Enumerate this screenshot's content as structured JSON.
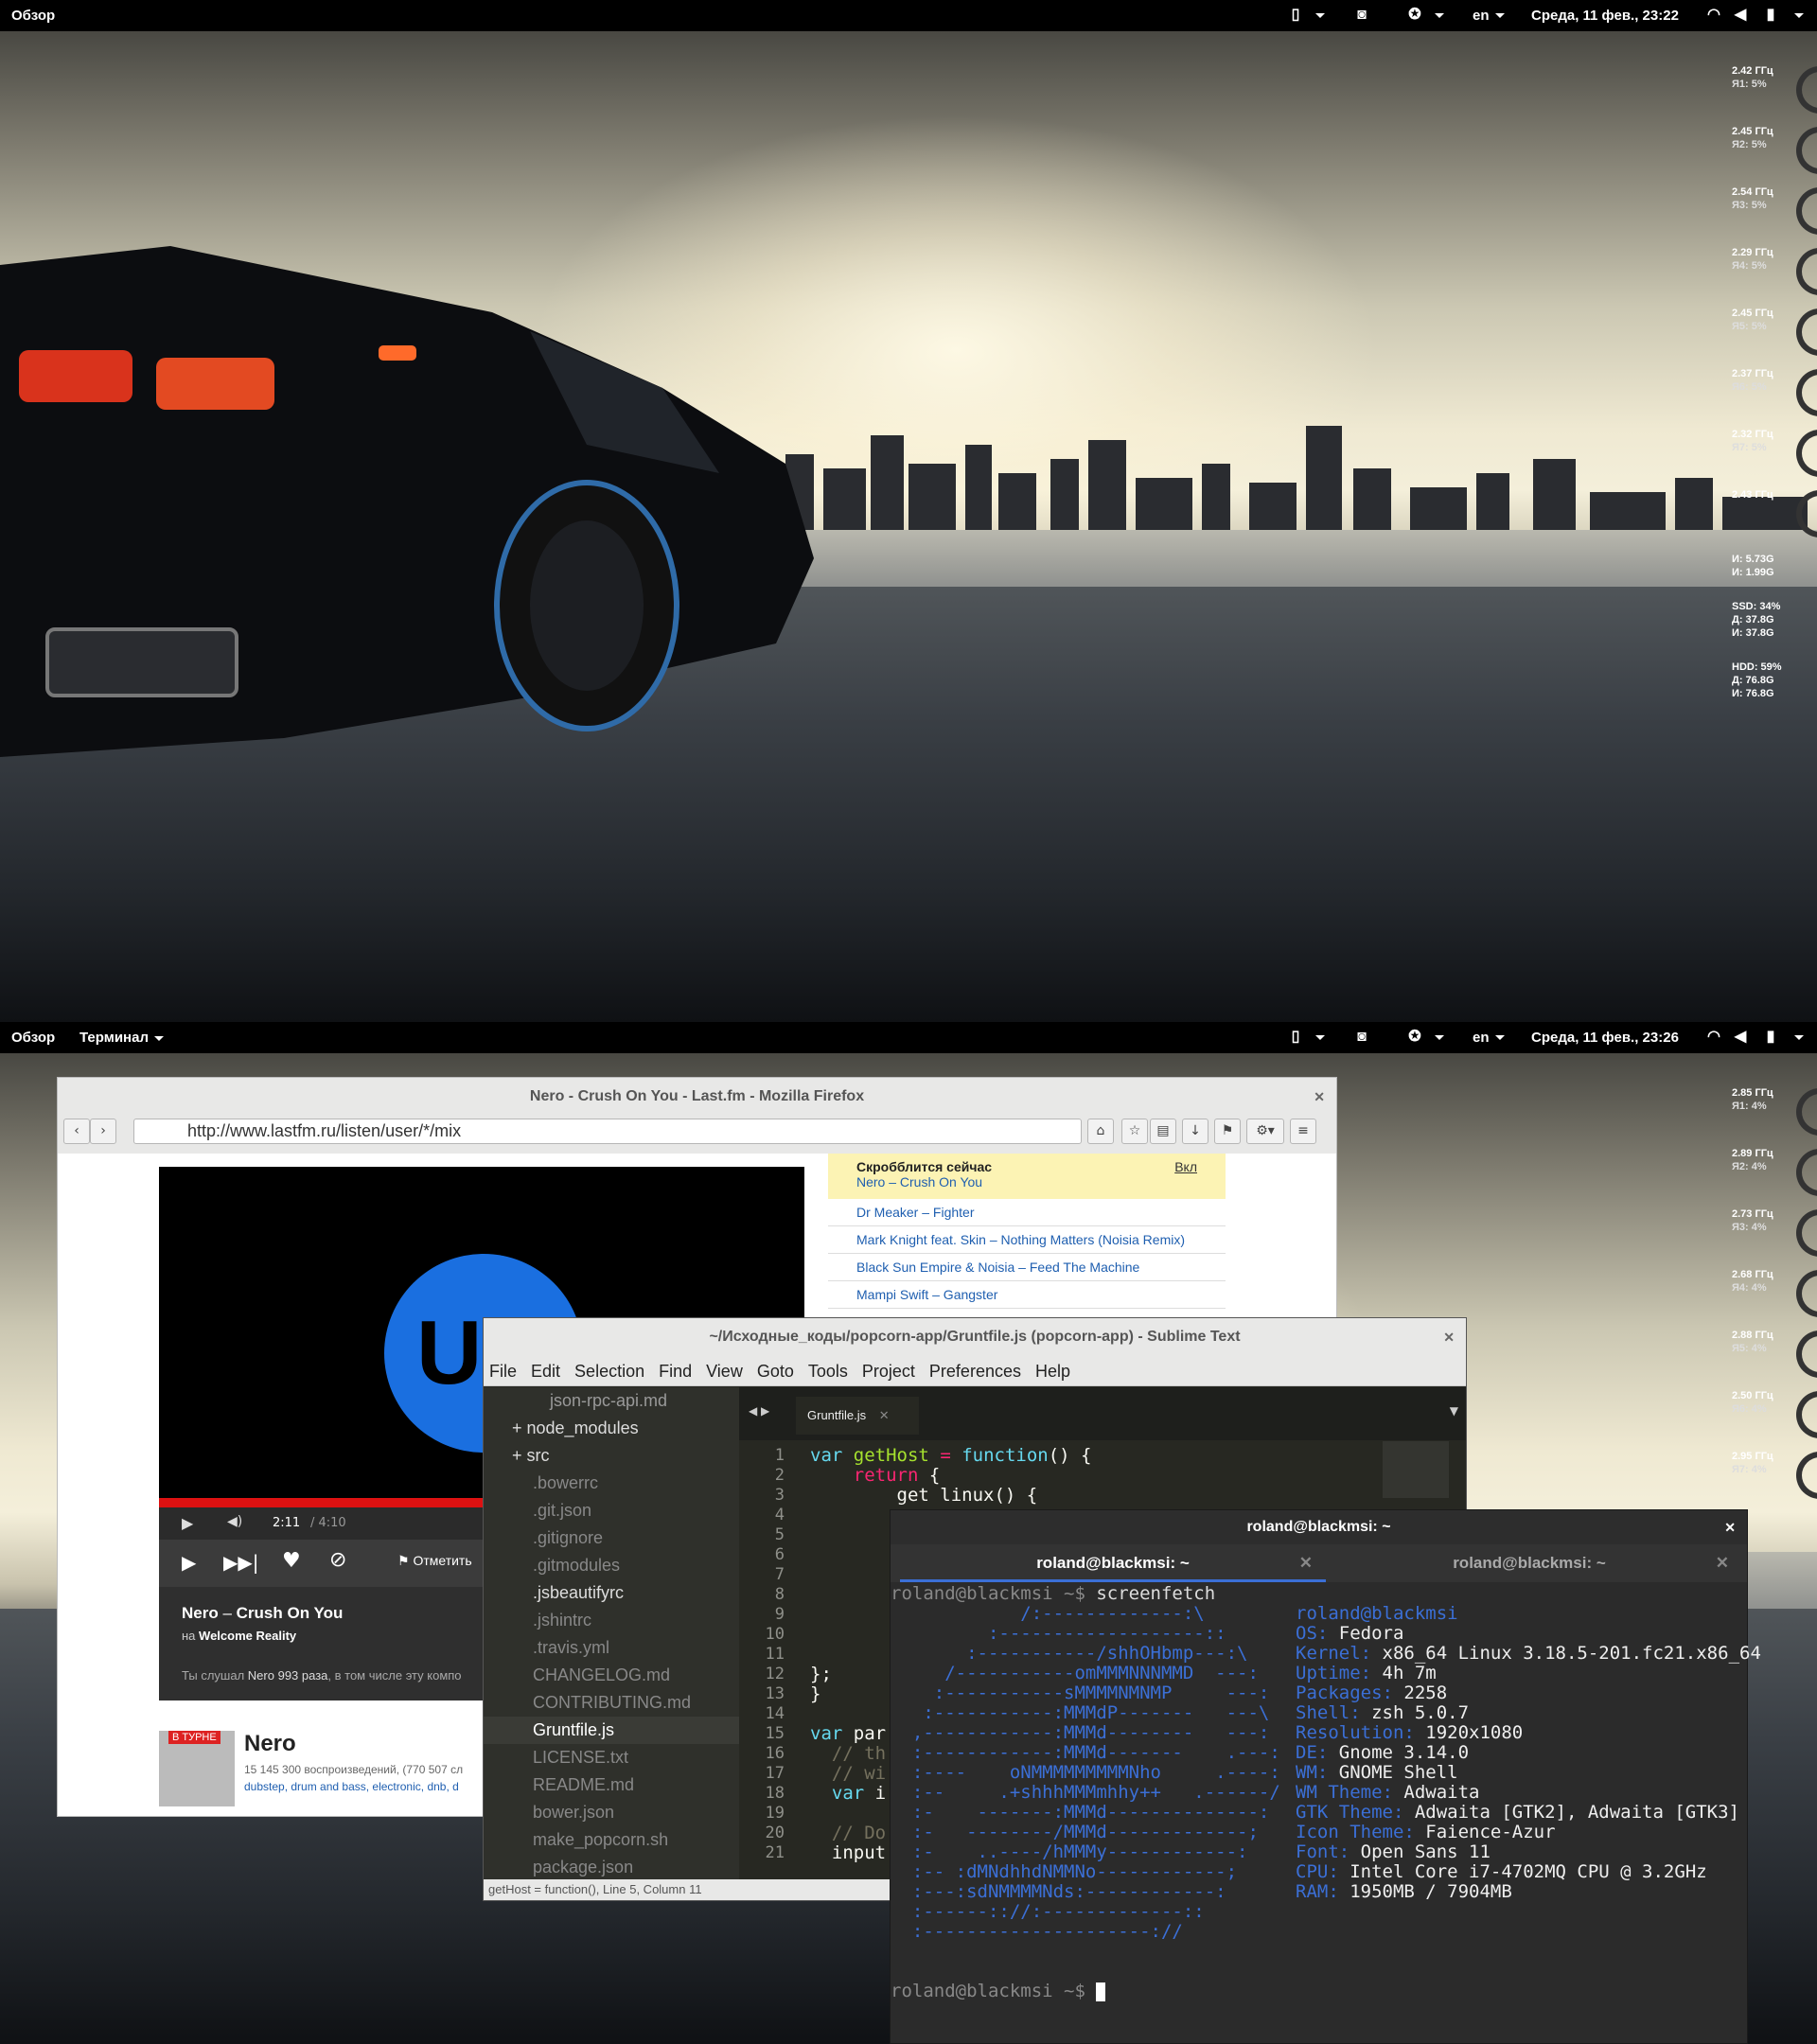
{
  "screen1": {
    "topbar": {
      "activities": "Обзор",
      "lang": "en",
      "clock": "Среда, 11 фев., 23:22"
    },
    "cpu": [
      {
        "freq": "2.42 ГГц",
        "load": "Я1: 5%"
      },
      {
        "freq": "2.45 ГГц",
        "load": "Я2: 5%"
      },
      {
        "freq": "2.54 ГГц",
        "load": "Я3: 5%"
      },
      {
        "freq": "2.29 ГГц",
        "load": "Я4: 5%"
      },
      {
        "freq": "2.45 ГГц",
        "load": "Я5: 5%"
      },
      {
        "freq": "2.37 ГГц",
        "load": "Я6: 5%"
      },
      {
        "freq": "2.32 ГГц",
        "load": "Я7: 5%"
      },
      {
        "freq": "2.43 ГГц",
        "load": ""
      }
    ],
    "mem": {
      "l1": "И: 5.73G",
      "l2": "И: 1.99G"
    },
    "ssd": {
      "l1": "SSD: 34%",
      "l2": "Д: 37.8G",
      "l3": "И: 37.8G"
    },
    "hdd": {
      "l1": "HDD: 59%",
      "l2": "Д: 76.8G",
      "l3": "И: 76.8G"
    }
  },
  "screen2": {
    "topbar": {
      "activities": "Обзор",
      "app_menu": "Терминал",
      "lang": "en",
      "clock": "Среда, 11 фев., 23:26"
    },
    "cpu": [
      {
        "freq": "2.85 ГГц",
        "load": "Я1: 4%"
      },
      {
        "freq": "2.89 ГГц",
        "load": "Я2: 4%"
      },
      {
        "freq": "2.73 ГГц",
        "load": "Я3: 4%"
      },
      {
        "freq": "2.68 ГГц",
        "load": "Я4: 4%"
      },
      {
        "freq": "2.88 ГГц",
        "load": "Я5: 4%"
      },
      {
        "freq": "2.50 ГГц",
        "load": "Я6: 4%"
      },
      {
        "freq": "2.95 ГГц",
        "load": "Я7: 4%"
      }
    ],
    "firefox": {
      "title": "Nero - Crush On You - Last.fm - Mozilla Firefox",
      "url": "http://www.lastfm.ru/listen/user/*/mix",
      "player": {
        "logo": "UK",
        "time": "2:11",
        "duration": "/ 4:10",
        "mark": "Отметить",
        "track_artist": "Nero",
        "track_sep": " – ",
        "track_title": "Crush On You",
        "on_prefix": "на",
        "album": "Welcome Reality",
        "played_prefix": "Ты слушал",
        "played_artist": "Nero",
        "played_count": "993 раза",
        "played_suffix": ", в том числе эту компо"
      },
      "scrobble": {
        "header": "Скробблится сейчас",
        "toggle": "Вкл",
        "now": "Nero – Crush On You",
        "rows": [
          "Dr Meaker – Fighter",
          "Mark Knight feat. Skin – Nothing Matters (Noisia Remix)",
          "Black Sun Empire & Noisia – Feed The Machine",
          "Mampi Swift – Gangster"
        ]
      },
      "artist": {
        "badge": "В ТУРНЕ",
        "name": "Nero",
        "stats": "15 145 300 воспроизведений, (770 507 сл",
        "tags": "dubstep, drum and bass, electronic, dnb, d"
      }
    },
    "sublime": {
      "title": "~/Исходные_коды/popcorn-app/Gruntfile.js (popcorn-app) - Sublime Text",
      "menu": [
        "File",
        "Edit",
        "Selection",
        "Find",
        "View",
        "Goto",
        "Tools",
        "Project",
        "Preferences",
        "Help"
      ],
      "tab": "Gruntfile.js",
      "files": [
        "json-rpc-api.md",
        "+ node_modules",
        "+ src",
        ".bowerrc",
        ".git.json",
        ".gitignore",
        ".gitmodules",
        ".jsbeautifyrc",
        ".jshintrc",
        ".travis.yml",
        "CHANGELOG.md",
        "CONTRIBUTING.md",
        "Gruntfile.js",
        "LICENSE.txt",
        "README.md",
        "bower.json",
        "make_popcorn.sh",
        "package.json"
      ],
      "lines": [
        "1",
        "2",
        "3",
        "4",
        "5",
        "6",
        "7",
        "8",
        "9",
        "10",
        "11",
        "12",
        "13",
        "14",
        "15",
        "16",
        "17",
        "18",
        "19",
        "20",
        "21"
      ],
      "status": "getHost = function(), Line 5, Column 11"
    },
    "terminal": {
      "title": "roland@blackmsi: ~",
      "tabs": [
        "roland@blackmsi: ~",
        "roland@blackmsi: ~"
      ],
      "prompt": "roland@blackmsi ~$ ",
      "command": "screenfetch",
      "user_host": "roland@blackmsi",
      "info": [
        {
          "k": "OS:",
          "v": " Fedora"
        },
        {
          "k": "Kernel:",
          "v": " x86_64 Linux 3.18.5-201.fc21.x86_64"
        },
        {
          "k": "Uptime:",
          "v": " 4h 7m"
        },
        {
          "k": "Packages:",
          "v": " 2258"
        },
        {
          "k": "Shell:",
          "v": " zsh 5.0.7"
        },
        {
          "k": "Resolution:",
          "v": " 1920x1080"
        },
        {
          "k": "DE:",
          "v": " Gnome 3.14.0"
        },
        {
          "k": "WM:",
          "v": " GNOME Shell"
        },
        {
          "k": "WM Theme:",
          "v": " Adwaita"
        },
        {
          "k": "GTK Theme:",
          "v": " Adwaita [GTK2], Adwaita [GTK3]"
        },
        {
          "k": "Icon Theme:",
          "v": " Faience-Azur"
        },
        {
          "k": "Font:",
          "v": " Open Sans 11"
        },
        {
          "k": "CPU:",
          "v": " Intel Core i7-4702MQ CPU @ 3.2GHz"
        },
        {
          "k": "RAM:",
          "v": " 1950MB / 7904MB"
        }
      ]
    }
  }
}
